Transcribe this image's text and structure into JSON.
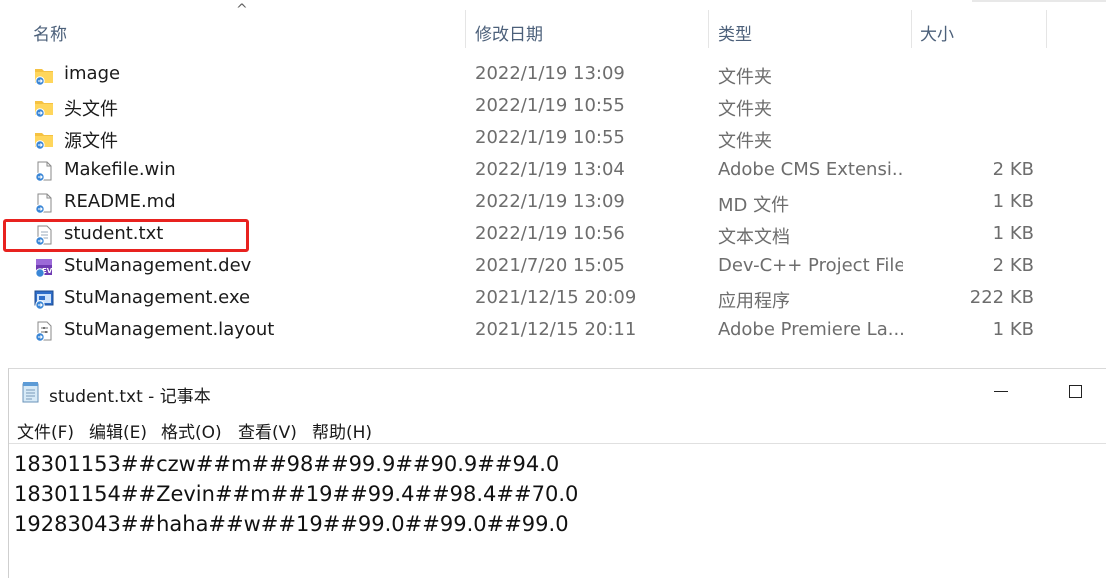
{
  "explorer": {
    "columns": {
      "name": "名称",
      "date": "修改日期",
      "type": "类型",
      "size": "大小"
    },
    "files": [
      {
        "name": "image",
        "date": "2022/1/19 13:09",
        "type": "文件夹",
        "size": "",
        "icon": "folder-icon"
      },
      {
        "name": "头文件",
        "date": "2022/1/19 10:55",
        "type": "文件夹",
        "size": "",
        "icon": "folder-icon"
      },
      {
        "name": "源文件",
        "date": "2022/1/19 10:55",
        "type": "文件夹",
        "size": "",
        "icon": "folder-icon"
      },
      {
        "name": "Makefile.win",
        "date": "2022/1/19 13:04",
        "type": "Adobe CMS Extensi...",
        "size": "2 KB",
        "icon": "file-icon"
      },
      {
        "name": "README.md",
        "date": "2022/1/19 13:09",
        "type": "MD 文件",
        "size": "1 KB",
        "icon": "file-icon"
      },
      {
        "name": "student.txt",
        "date": "2022/1/19 10:56",
        "type": "文本文档",
        "size": "1 KB",
        "icon": "text-file-icon"
      },
      {
        "name": "StuManagement.dev",
        "date": "2021/7/20 15:05",
        "type": "Dev-C++ Project File",
        "size": "2 KB",
        "icon": "devcpp-project-icon"
      },
      {
        "name": "StuManagement.exe",
        "date": "2021/12/15 20:09",
        "type": "应用程序",
        "size": "222 KB",
        "icon": "exe-icon"
      },
      {
        "name": "StuManagement.layout",
        "date": "2021/12/15 20:11",
        "type": "Adobe Premiere La...",
        "size": "1 KB",
        "icon": "layout-file-icon"
      }
    ],
    "highlight_color": "#e8221f"
  },
  "notepad": {
    "title": "student.txt - 记事本",
    "menu": [
      "文件(F)",
      "编辑(E)",
      "格式(O)",
      "查看(V)",
      "帮助(H)"
    ],
    "lines": [
      "18301153##czw##m##98##99.9##90.9##94.0",
      "18301154##Zevin##m##19##99.4##98.4##70.0",
      "19283043##haha##w##19##99.0##99.0##99.0"
    ]
  }
}
